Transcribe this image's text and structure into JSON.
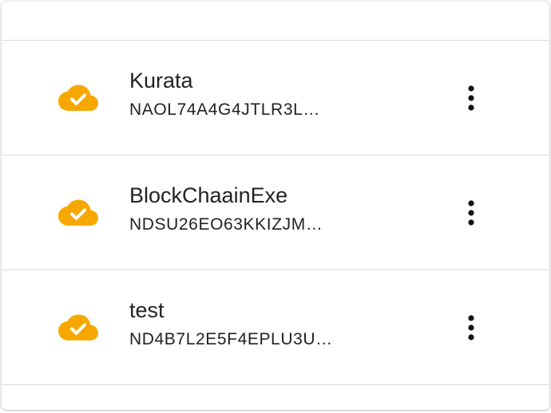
{
  "accounts": [
    {
      "name": "Kurata",
      "address": "NAOL74A4G4JTLR3L…",
      "status_icon": "cloud-done-icon",
      "menu_icon": "more-vert-icon"
    },
    {
      "name": "BlockChaainExe",
      "address": "NDSU26EO63KKIZJM…",
      "status_icon": "cloud-done-icon",
      "menu_icon": "more-vert-icon"
    },
    {
      "name": "test",
      "address": "ND4B7L2E5F4EPLU3U…",
      "status_icon": "cloud-done-icon",
      "menu_icon": "more-vert-icon"
    }
  ],
  "colors": {
    "cloud": "#F7A800",
    "text": "#222222",
    "divider": "#DCDCDC"
  }
}
